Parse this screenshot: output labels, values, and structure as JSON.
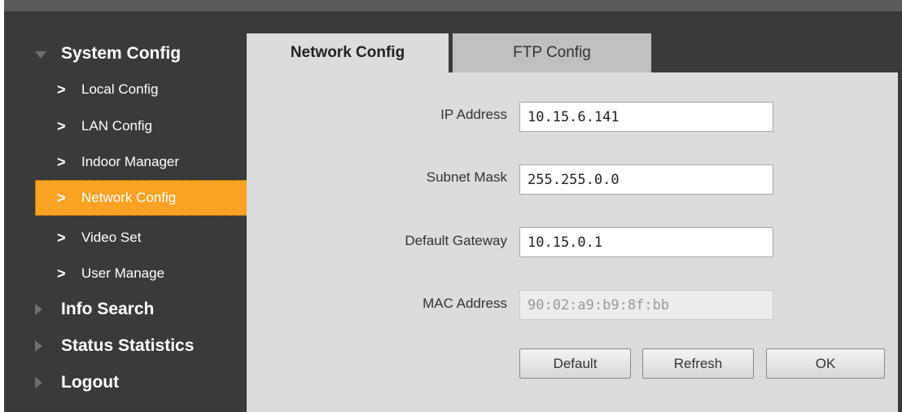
{
  "sidebar": {
    "sections": [
      {
        "label": "System Config",
        "expanded": true
      },
      {
        "label": "Info Search",
        "expanded": false
      },
      {
        "label": "Status Statistics",
        "expanded": false
      },
      {
        "label": "Logout",
        "expanded": false
      }
    ],
    "items": [
      {
        "label": "Local Config"
      },
      {
        "label": "LAN Config"
      },
      {
        "label": "Indoor Manager"
      },
      {
        "label": "Network Config",
        "active": true
      },
      {
        "label": "Video Set"
      },
      {
        "label": "User Manage"
      }
    ],
    "chevron": ">"
  },
  "tabs": [
    {
      "label": "Network Config",
      "selected": true
    },
    {
      "label": "FTP Config",
      "selected": false
    }
  ],
  "form": {
    "ip": {
      "label": "IP Address",
      "value": "10.15.6.141"
    },
    "mask": {
      "label": "Subnet Mask",
      "value": "255.255.0.0"
    },
    "gateway": {
      "label": "Default Gateway",
      "value": "10.15.0.1"
    },
    "mac": {
      "label": "MAC Address",
      "value": "90:02:a9:b9:8f:bb",
      "disabled": true
    }
  },
  "buttons": {
    "default": "Default",
    "refresh": "Refresh",
    "ok": "OK"
  },
  "colors": {
    "sidebar_bg": "#3a3a3a",
    "active_item": "#f9a223",
    "panel_bg": "#dcdcdc",
    "inactive_tab": "#bfbfbf"
  },
  "icons": {
    "expanded_section": "triangle-down-icon",
    "collapsed_section": "triangle-right-icon",
    "sub_item": "chevron-right-icon"
  }
}
